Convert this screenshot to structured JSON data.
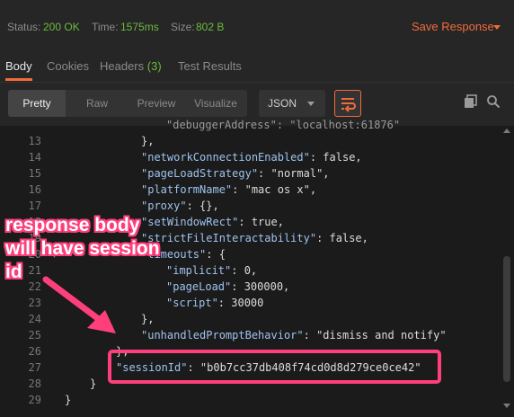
{
  "status_bar": {
    "status_label": "Status:",
    "status_value": "200 OK",
    "time_label": "Time:",
    "time_value": "1575ms",
    "size_label": "Size:",
    "size_value": "802 B",
    "save_response_label": "Save Response"
  },
  "tabs": [
    {
      "label": "Body",
      "active": true
    },
    {
      "label": "Cookies"
    },
    {
      "label": "Headers",
      "count": "(3)"
    },
    {
      "label": "Test Results"
    }
  ],
  "toolbar": {
    "views": [
      "Pretty",
      "Raw",
      "Preview",
      "Visualize"
    ],
    "active_view": "Pretty",
    "format_value": "JSON"
  },
  "editor": {
    "lines": [
      {
        "num": "13",
        "text": "},"
      },
      {
        "num": "14",
        "key": "\"networkConnectionEnabled\"",
        "rest": ": false,"
      },
      {
        "num": "15",
        "key": "\"pageLoadStrategy\"",
        "rest": ": \"normal\","
      },
      {
        "num": "16",
        "key": "\"platformName\"",
        "rest": ": \"mac os x\","
      },
      {
        "num": "17",
        "key": "\"proxy\"",
        "rest": ": {},"
      },
      {
        "num": "18",
        "key": "\"setWindowRect\"",
        "rest": ": true,"
      },
      {
        "num": "19",
        "key": "\"strictFileInteractability\"",
        "rest": ": false,"
      },
      {
        "num": "20",
        "key": "\"timeouts\"",
        "rest": ": {"
      },
      {
        "num": "21",
        "key": "\"implicit\"",
        "rest": ": 0,"
      },
      {
        "num": "22",
        "key": "\"pageLoad\"",
        "rest": ": 300000,"
      },
      {
        "num": "23",
        "key": "\"script\"",
        "rest": ": 30000"
      },
      {
        "num": "24",
        "text": "},"
      },
      {
        "num": "25",
        "key": "\"unhandledPromptBehavior\"",
        "rest": ": \"dismiss and notify\""
      },
      {
        "num": "26",
        "text": "},"
      },
      {
        "num": "27",
        "key": "\"sessionId\"",
        "rest": ": \"b0b7cc37db408f74cd0d8d279ce0ce42\""
      },
      {
        "num": "28",
        "text": "}"
      },
      {
        "num": "29",
        "text": "}"
      }
    ],
    "partial_top_line": "\"debuggerAddress\": \"localhost:61876\""
  },
  "annotation": {
    "lines": [
      "response body",
      "will have session",
      "id"
    ],
    "color": "#ff3f7c"
  },
  "colors": {
    "accent": "#f26b3a",
    "status_ok": "#6cba3c",
    "json_key": "#9ec3ee",
    "annotation": "#ff3f7c"
  },
  "icons": [
    "copy-icon",
    "search-icon",
    "wrap-lines-icon",
    "chevron-down-icon"
  ]
}
